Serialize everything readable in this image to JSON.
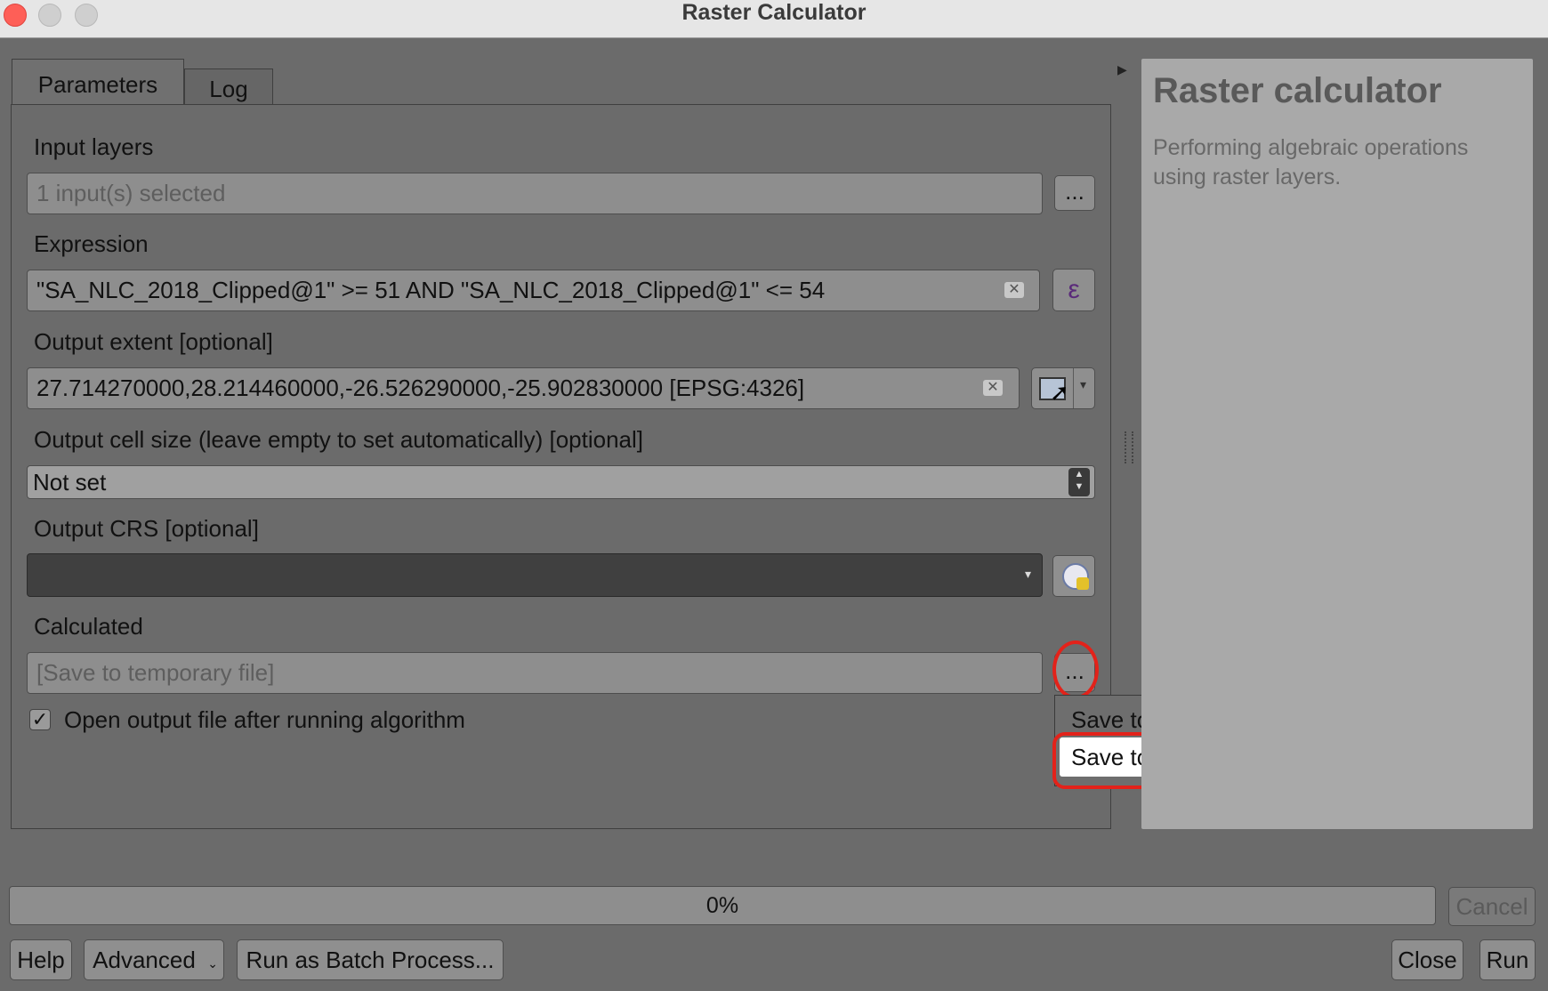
{
  "window": {
    "title": "Raster Calculator"
  },
  "tabs": [
    {
      "label": "Parameters"
    },
    {
      "label": "Log"
    }
  ],
  "params": {
    "input_layers": {
      "label": "Input layers",
      "value": "1 input(s) selected",
      "button": "..."
    },
    "expression": {
      "label": "Expression",
      "value": "\"SA_NLC_2018_Clipped@1\" >= 51 AND \"SA_NLC_2018_Clipped@1\" <= 54",
      "button_icon": "ε"
    },
    "output_extent": {
      "label": "Output extent [optional]",
      "value": "27.714270000,28.214460000,-26.526290000,-25.902830000 [EPSG:4326]"
    },
    "cell_size": {
      "label": "Output cell size (leave empty to set automatically) [optional]",
      "value": "Not set"
    },
    "output_crs": {
      "label": "Output CRS [optional]",
      "value": ""
    },
    "calculated": {
      "label": "Calculated",
      "placeholder": "[Save to temporary file]",
      "button": "..."
    },
    "open_output": {
      "label": "Open output file after running algorithm",
      "checked": true
    }
  },
  "menu": {
    "items": [
      {
        "label": "Save to a Temporary File"
      },
      {
        "label": "Save to File…"
      }
    ]
  },
  "help": {
    "title": "Raster calculator",
    "description": "Performing algebraic operations using raster layers."
  },
  "progress": {
    "value": "0%",
    "percent": 0
  },
  "buttons": {
    "cancel": "Cancel",
    "help": "Help",
    "advanced": "Advanced",
    "batch": "Run as Batch Process...",
    "close": "Close",
    "run": "Run"
  },
  "colors": {
    "highlight": "#e3221a",
    "help_panel": "#a9a9a9"
  }
}
